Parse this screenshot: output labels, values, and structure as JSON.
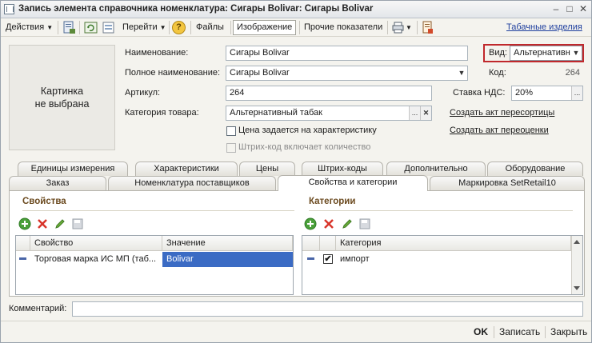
{
  "window": {
    "title": "Запись элемента справочника номенклатура: Сигары Bolivar: Сигары Bolivar",
    "minimize": "–",
    "maximize": "□",
    "close": "✕"
  },
  "toolbar": {
    "actions": "Действия",
    "goto": "Перейти",
    "files": "Файлы",
    "image": "Изображение",
    "other_indicators": "Прочие показатели",
    "tabular_products": "Табачные изделия",
    "help_glyph": "?"
  },
  "picture_placeholder": {
    "line1": "Картинка",
    "line2": "не выбрана"
  },
  "form": {
    "name_label": "Наименование:",
    "name_value": "Сигары Bolivar",
    "full_name_label": "Полное наименование:",
    "full_name_value": "Сигары Bolivar",
    "article_label": "Артикул:",
    "article_value": "264",
    "category_label": "Категория товара:",
    "category_value": "Альтернативный табак",
    "price_by_characteristic": "Цена задается на характеристику",
    "barcode_includes_qty": "Штрих-код включает количество",
    "view_label": "Вид:",
    "view_value": "Альтернативн",
    "code_label": "Код:",
    "code_value": "264",
    "vat_label": "Ставка НДС:",
    "vat_value": "20%",
    "create_regrading": "Создать акт пересортицы",
    "create_revaluation": "Создать акт переоценки",
    "ellipsis": "...",
    "clear": "✕",
    "dropdown": "▼"
  },
  "tabs_row1": [
    "Единицы измерения",
    "Характеристики",
    "Цены",
    "Штрих-коды",
    "Дополнительно",
    "Оборудование"
  ],
  "tabs_row2": [
    "Заказ",
    "Номенклатура поставщиков",
    "Свойства и категории",
    "Маркировка SetRetail10"
  ],
  "properties": {
    "title": "Свойства",
    "col_property": "Свойство",
    "col_value": "Значение",
    "rows": [
      {
        "property": "Торговая марка ИС МП (таб...",
        "value": "Bolivar"
      }
    ]
  },
  "categories": {
    "title": "Категории",
    "col_category": "Категория",
    "rows": [
      {
        "checked": true,
        "category": "импорт"
      }
    ]
  },
  "comment": {
    "label": "Комментарий:",
    "value": ""
  },
  "footer": {
    "ok": "OK",
    "save": "Записать",
    "close": "Закрыть"
  },
  "colors": {
    "highlight_border": "#c0282c",
    "selection": "#3b6bc4",
    "section_title": "#6b4a1f",
    "link": "#1f3f9e"
  }
}
